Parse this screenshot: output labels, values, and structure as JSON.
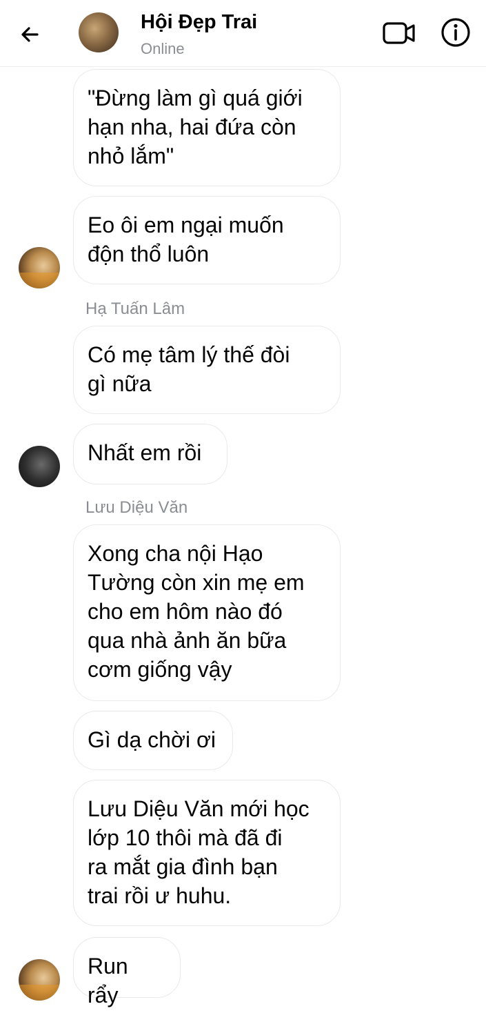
{
  "header": {
    "title": "Hội Đẹp Trai",
    "status": "Online",
    "icons": {
      "back": "back-arrow-icon",
      "video": "video-call-icon",
      "info": "info-icon"
    }
  },
  "messages": [
    {
      "text": "\"Đừng làm gì quá giới\nhạn nha, hai đứa còn\nnhỏ lắm\""
    },
    {
      "text": "Eo ôi em ngại muốn\nđộn thổ luôn"
    },
    {
      "sender": "Hạ Tuấn Lâm"
    },
    {
      "text": "Có mẹ tâm lý thế đòi\ngì nữa"
    },
    {
      "text": "Nhất em rồi"
    },
    {
      "sender": "Lưu Diệu Văn"
    },
    {
      "text": "Xong cha nội Hạo\nTường còn xin mẹ em\ncho em hôm nào đó\nqua nhà ảnh ăn bữa\ncơm giống vậy"
    },
    {
      "text": "Gì dạ chời ơi"
    },
    {
      "text": "Lưu Diệu Văn mới học\nlớp 10 thôi mà đã đi\nra mắt gia đình bạn\ntrai rồi ư huhu."
    },
    {
      "text": "Run rẩy"
    }
  ],
  "colors": {
    "bubble_border": "#e8e9eb",
    "meta_text": "#8a8d91"
  }
}
